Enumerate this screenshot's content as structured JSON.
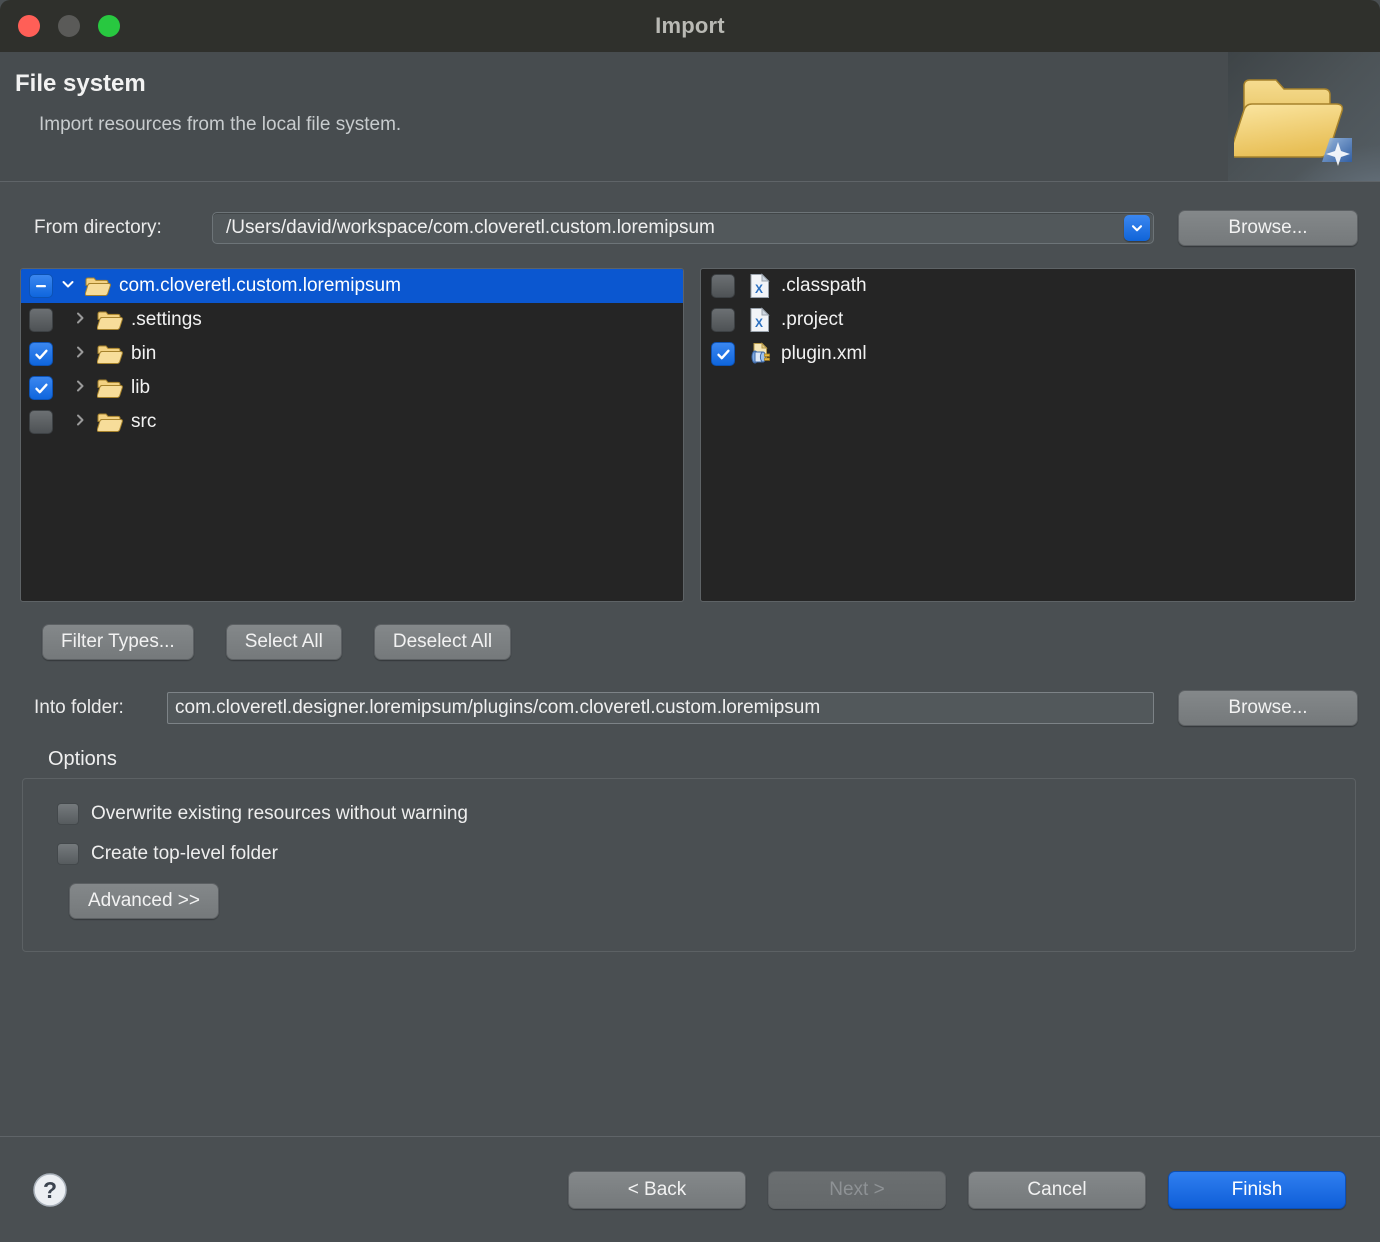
{
  "window": {
    "title": "Import",
    "traffic_lights": [
      "close-button",
      "minimize-button",
      "zoom-button"
    ]
  },
  "header": {
    "title": "File system",
    "subtitle": "Import resources from the local file system.",
    "icon": "open-folder-icon"
  },
  "source": {
    "label": "From directory:",
    "value": "/Users/david/workspace/com.cloveretl.custom.loremipsum",
    "dropdown_icon": "chevron-down-icon",
    "browse_label": "Browse..."
  },
  "tree": {
    "root": {
      "label": "com.cloveretl.custom.loremipsum",
      "check_state": "mixed",
      "expanded": true,
      "selected": true,
      "icon": "open-folder-icon"
    },
    "children": [
      {
        "label": ".settings",
        "check_state": "unchecked",
        "expanded": false,
        "icon": "open-folder-icon"
      },
      {
        "label": "bin",
        "check_state": "checked",
        "expanded": false,
        "icon": "open-folder-icon"
      },
      {
        "label": "lib",
        "check_state": "checked",
        "expanded": false,
        "icon": "open-folder-icon"
      },
      {
        "label": "src",
        "check_state": "unchecked",
        "expanded": false,
        "icon": "open-folder-icon"
      }
    ]
  },
  "files": [
    {
      "label": ".classpath",
      "check_state": "unchecked",
      "icon": "xml-file-icon"
    },
    {
      "label": ".project",
      "check_state": "unchecked",
      "icon": "xml-file-icon"
    },
    {
      "label": "plugin.xml",
      "check_state": "checked",
      "icon": "plugin-file-icon"
    }
  ],
  "selection_buttons": {
    "filter_types": "Filter Types...",
    "select_all": "Select All",
    "deselect_all": "Deselect All"
  },
  "destination": {
    "label": "Into folder:",
    "value": "com.cloveretl.designer.loremipsum/plugins/com.cloveretl.custom.loremipsum",
    "browse_label": "Browse..."
  },
  "options": {
    "legend": "Options",
    "items": [
      {
        "label": "Overwrite existing resources without warning",
        "checked": false
      },
      {
        "label": "Create top-level folder",
        "checked": false
      }
    ],
    "advanced_label": "Advanced >>"
  },
  "footer": {
    "help_icon": "help-question-icon",
    "back_label": "< Back",
    "next_label": "Next >",
    "next_disabled": true,
    "cancel_label": "Cancel",
    "finish_label": "Finish"
  },
  "colors": {
    "accent_blue": "#0b57d0",
    "dialog_bg": "#4a4f52",
    "list_bg": "#252525",
    "titlebar_bg": "#2f302c",
    "finish_blue": "#1064d8"
  }
}
